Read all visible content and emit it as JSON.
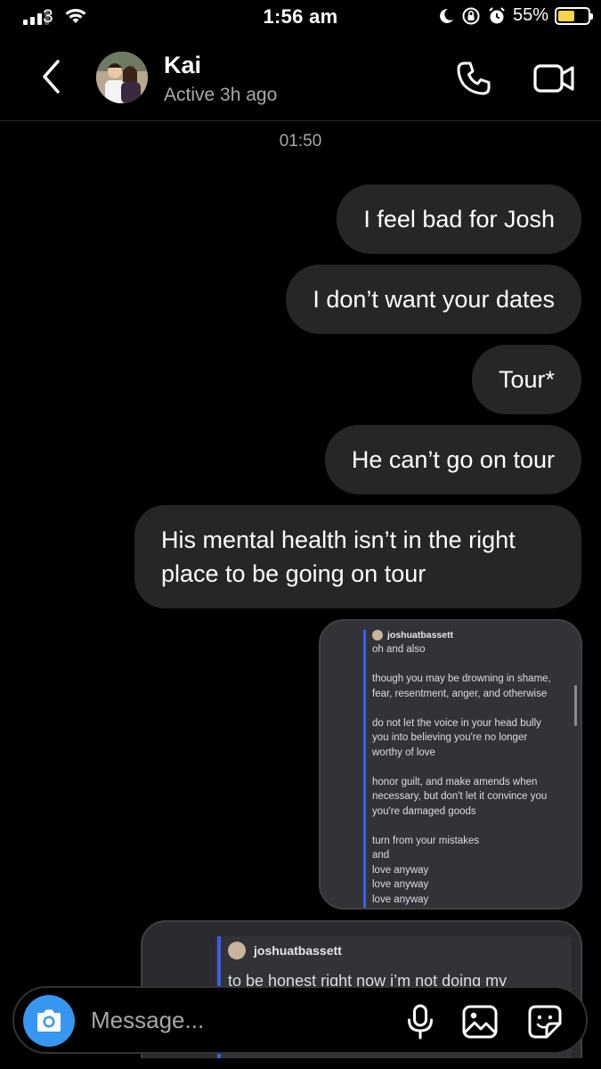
{
  "status_bar": {
    "carrier": "3",
    "time": "1:56 am",
    "battery_percent": "55%",
    "battery_level": 0.55,
    "icons": [
      "signal-icon",
      "wifi-icon",
      "moon-icon",
      "orientation-lock-icon",
      "alarm-icon",
      "battery-icon"
    ]
  },
  "header": {
    "contact_name": "Kai",
    "contact_status": "Active 3h ago",
    "icons": [
      "back-icon",
      "avatar",
      "phone-icon",
      "video-call-icon"
    ]
  },
  "conversation": {
    "timestamp": "01:50",
    "messages": [
      {
        "text": "I feel bad for Josh",
        "direction": "sent"
      },
      {
        "text": "I don’t want your dates",
        "direction": "sent"
      },
      {
        "text": "Tour*",
        "direction": "sent"
      },
      {
        "text": "He can’t go on tour",
        "direction": "sent"
      },
      {
        "text": "His mental health isn’t in the right place to be going on tour",
        "direction": "sent"
      }
    ],
    "shared_post_1": {
      "author": "joshuatbassett",
      "lines": [
        "oh and also",
        "",
        "though you may be drowning in shame,",
        "fear, resentment, anger, and otherwise",
        "",
        "do not let the voice in your head bully",
        "you into believing you're no longer",
        "worthy of love",
        "",
        "honor guilt, and make amends when",
        "necessary, but don't let it convince you",
        "you're damaged goods",
        "",
        "turn from your mistakes",
        "and",
        "love anyway",
        "love anyway",
        "love anyway"
      ]
    },
    "shared_post_2": {
      "author": "joshuatbassett",
      "text": "to be honest right now i’m not doing my"
    }
  },
  "composer": {
    "placeholder": "Message...",
    "icons": [
      "camera-icon",
      "microphone-icon",
      "gallery-icon",
      "sticker-icon"
    ]
  },
  "colors": {
    "background": "#000000",
    "bubble": "#262626",
    "secondary_text": "#a8a8a8",
    "camera_button": "#3797f0",
    "quote_bar": "#3b5de7",
    "battery_fill": "#f7d34a"
  }
}
